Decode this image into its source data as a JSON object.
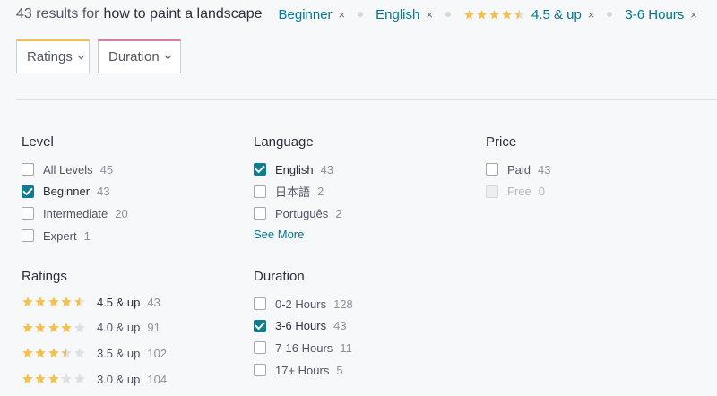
{
  "header": {
    "results_count_text": "43 results for",
    "query": "how to paint a landscape",
    "chips": [
      {
        "label": "Beginner"
      },
      {
        "label": "English"
      },
      {
        "label": "4.5 & up",
        "stars": 4.5
      },
      {
        "label": "3-6 Hours"
      }
    ],
    "close_glyph": "×"
  },
  "dropdowns": {
    "ratings_label": "Ratings",
    "duration_label": "Duration"
  },
  "filters": {
    "level": {
      "title": "Level",
      "options": [
        {
          "label": "All Levels",
          "count": "45",
          "checked": false
        },
        {
          "label": "Beginner",
          "count": "43",
          "checked": true
        },
        {
          "label": "Intermediate",
          "count": "20",
          "checked": false
        },
        {
          "label": "Expert",
          "count": "1",
          "checked": false
        }
      ]
    },
    "language": {
      "title": "Language",
      "options": [
        {
          "label": "English",
          "count": "43",
          "checked": true
        },
        {
          "label": "日本語",
          "count": "2",
          "checked": false
        },
        {
          "label": "Português",
          "count": "2",
          "checked": false
        }
      ],
      "see_more": "See More"
    },
    "price": {
      "title": "Price",
      "options": [
        {
          "label": "Paid",
          "count": "43",
          "checked": false,
          "disabled": false
        },
        {
          "label": "Free",
          "count": "0",
          "checked": false,
          "disabled": true
        }
      ]
    },
    "ratings": {
      "title": "Ratings",
      "options": [
        {
          "label": "4.5 & up",
          "count": "43",
          "stars": 4.5
        },
        {
          "label": "4.0 & up",
          "count": "91",
          "stars": 4.0
        },
        {
          "label": "3.5 & up",
          "count": "102",
          "stars": 3.5
        },
        {
          "label": "3.0 & up",
          "count": "104",
          "stars": 3.0
        }
      ]
    },
    "duration": {
      "title": "Duration",
      "options": [
        {
          "label": "0-2 Hours",
          "count": "128",
          "checked": false
        },
        {
          "label": "3-6 Hours",
          "count": "43",
          "checked": true
        },
        {
          "label": "7-16 Hours",
          "count": "11",
          "checked": false
        },
        {
          "label": "17+ Hours",
          "count": "5",
          "checked": false
        }
      ]
    }
  },
  "colors": {
    "accent": "#007791",
    "checkbox_checked": "#0f7c90",
    "star": "#f4c150",
    "star_empty": "#dedfe0",
    "ratings_dropdown_border": "#f4c150",
    "duration_dropdown_border": "#d87ea7"
  },
  "icons": {
    "chip_close": "close-icon",
    "dropdown_chevron": "chevron-down-icon",
    "star": "star-icon",
    "checkbox": "checkbox-icon"
  }
}
